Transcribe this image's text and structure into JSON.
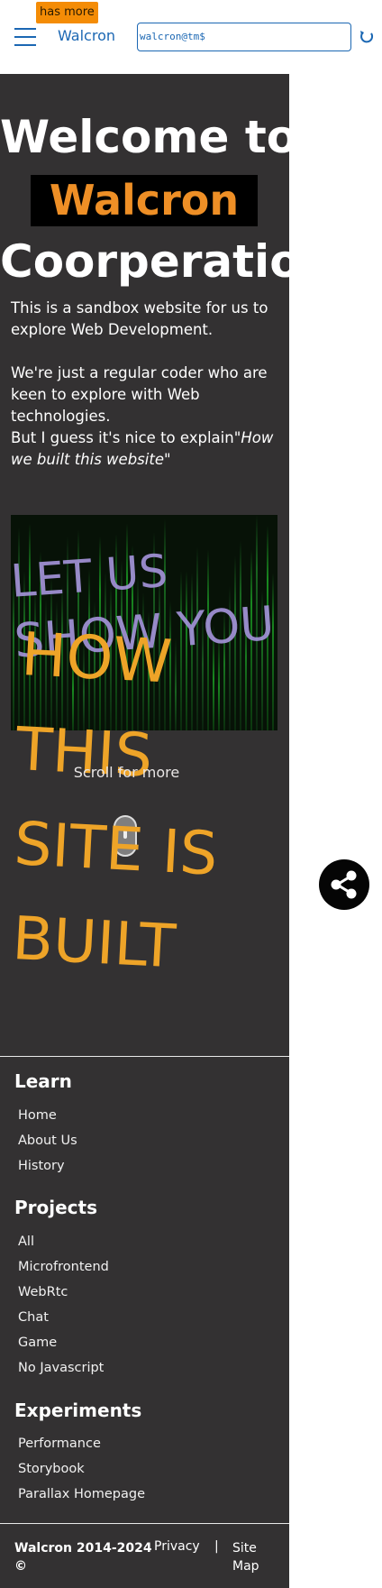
{
  "header": {
    "badge": "has more",
    "brand": "Walcron",
    "terminal_value": "walcron@tm$"
  },
  "hero": {
    "welcome": "Welcome to",
    "brand": "Walcron",
    "coop": "Coorperatio",
    "intro_1": "This is a sandbox website for us to explore Web Development.",
    "intro_2": "We're just a regular coder who are keen to explore with Web technologies.",
    "intro_3_pre": "But I guess it's nice to explain\"",
    "intro_3_em": "How we built this website",
    "intro_3_post": "\"",
    "lilac_1": "LET US",
    "lilac_2": "SHOW YOU",
    "orange_1": "HOW",
    "orange_2": "THIS",
    "orange_3": "SITE IS",
    "orange_4": "BUILT",
    "scroll_label": "Scroll for more"
  },
  "footer": {
    "sections": [
      {
        "title": "Learn",
        "links": [
          "Home",
          "About Us",
          "History"
        ]
      },
      {
        "title": "Projects",
        "links": [
          "All",
          "Microfrontend",
          "WebRtc",
          "Chat",
          "Game",
          "No Javascript"
        ]
      },
      {
        "title": "Experiments",
        "links": [
          "Performance",
          "Storybook",
          "Parallax Homepage"
        ]
      }
    ],
    "copyright_line1": "Walcron 2014-2024",
    "copyright_line2": "©",
    "privacy": "Privacy",
    "separator": "|",
    "sitemap": "Site Map"
  },
  "colors": {
    "brand_blue": "#1b67b3",
    "badge_orange": "#f48c06",
    "hero_bg": "#333132",
    "accent_orange": "#ee8f26",
    "lilac": "#a393d8"
  },
  "icons": [
    "hamburger-icon",
    "refresh-icon",
    "share-icon",
    "mouse-scroll-icon"
  ]
}
